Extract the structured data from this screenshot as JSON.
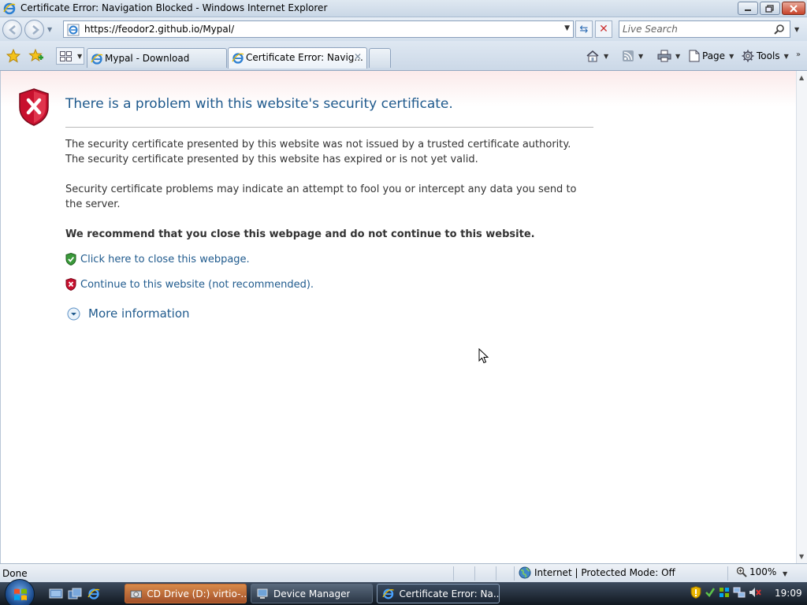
{
  "window": {
    "title": "Certificate Error: Navigation Blocked - Windows Internet Explorer"
  },
  "address_bar": {
    "url": "https://feodor2.github.io/Mypal/"
  },
  "search": {
    "placeholder": "Live Search"
  },
  "tabs": [
    {
      "label": "Mypal - Download",
      "active": false
    },
    {
      "label": "Certificate Error: Navig...",
      "active": true
    }
  ],
  "command_bar": {
    "page_label": "Page",
    "tools_label": "Tools"
  },
  "content": {
    "heading": "There is a problem with this website's security certificate.",
    "line1": "The security certificate presented by this website was not issued by a trusted certificate authority.",
    "line2": "The security certificate presented by this website has expired or is not yet valid.",
    "line3": "Security certificate problems may indicate an attempt to fool you or intercept any data you send to the server.",
    "recommendation": "We recommend that you close this webpage and do not continue to this website.",
    "close_link": "Click here to close this webpage.",
    "continue_link": "Continue to this website (not recommended).",
    "more_info": "More information"
  },
  "status_bar": {
    "status": "Done",
    "zone": "Internet | Protected Mode: Off",
    "zoom": "100%"
  },
  "taskbar": {
    "items": [
      {
        "label": "CD Drive (D:) virtio-..."
      },
      {
        "label": "Device Manager"
      },
      {
        "label": "Certificate Error: Na..."
      }
    ],
    "clock": "19:09"
  },
  "colors": {
    "link": "#1f5a8d",
    "error_red": "#c8102e",
    "safe_green": "#3a9a3a"
  }
}
